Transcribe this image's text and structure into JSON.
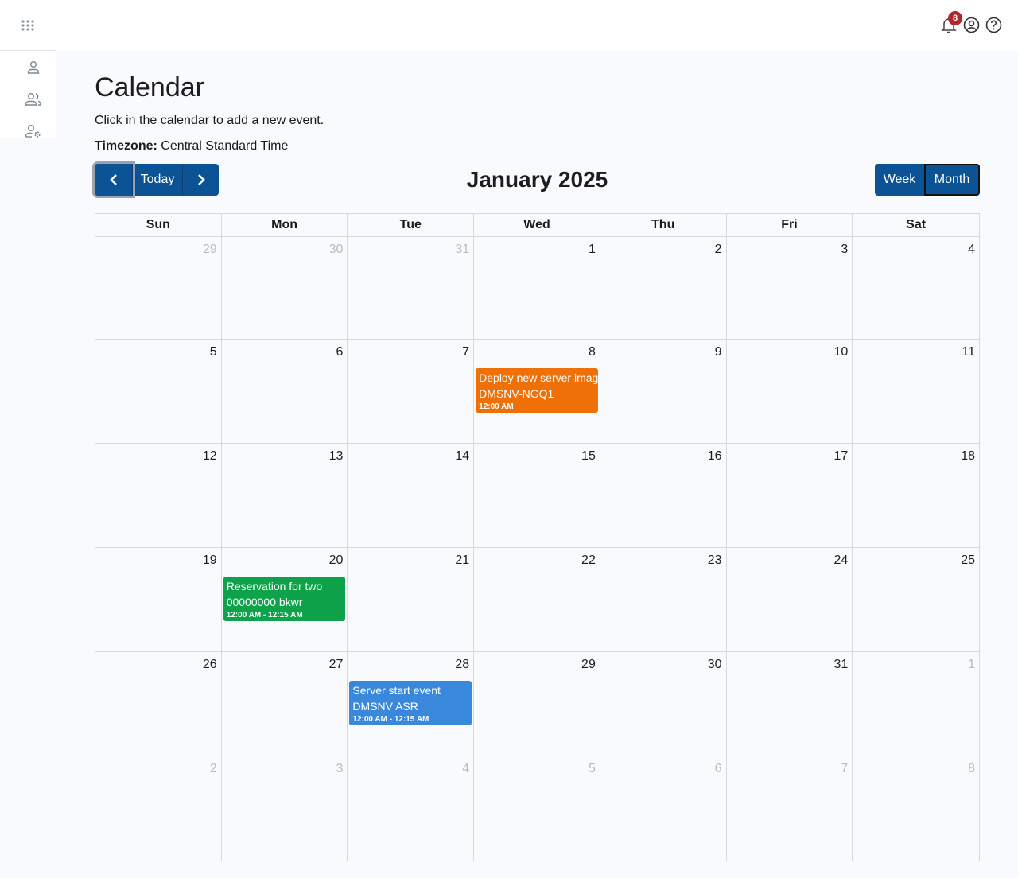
{
  "header": {
    "notifications_count": "8",
    "icons": [
      "apps-grid-icon",
      "bell-icon",
      "user-circle-icon",
      "help-icon"
    ]
  },
  "sidebar": {
    "items": [
      {
        "icon": "user-icon",
        "label": "User"
      },
      {
        "icon": "users-icon",
        "label": "Users"
      },
      {
        "icon": "user-settings-icon",
        "label": "User settings"
      }
    ]
  },
  "page": {
    "title": "Calendar",
    "subtitle": "Click in the calendar to add a new event.",
    "timezone_label": "Timezone:",
    "timezone_value": "Central Standard Time"
  },
  "toolbar": {
    "prev_label": "‹",
    "today_label": "Today",
    "next_label": "›",
    "month_title": "January 2025",
    "week_label": "Week",
    "month_label": "Month",
    "active_view": "Month"
  },
  "calendar": {
    "weekdays": [
      "Sun",
      "Mon",
      "Tue",
      "Wed",
      "Thu",
      "Fri",
      "Sat"
    ],
    "weeks": [
      [
        {
          "d": "29",
          "other": true
        },
        {
          "d": "30",
          "other": true
        },
        {
          "d": "31",
          "other": true
        },
        {
          "d": "1"
        },
        {
          "d": "2"
        },
        {
          "d": "3"
        },
        {
          "d": "4"
        }
      ],
      [
        {
          "d": "5"
        },
        {
          "d": "6"
        },
        {
          "d": "7"
        },
        {
          "d": "8"
        },
        {
          "d": "9"
        },
        {
          "d": "10"
        },
        {
          "d": "11"
        }
      ],
      [
        {
          "d": "12"
        },
        {
          "d": "13"
        },
        {
          "d": "14"
        },
        {
          "d": "15"
        },
        {
          "d": "16"
        },
        {
          "d": "17"
        },
        {
          "d": "18"
        }
      ],
      [
        {
          "d": "19"
        },
        {
          "d": "20"
        },
        {
          "d": "21"
        },
        {
          "d": "22"
        },
        {
          "d": "23"
        },
        {
          "d": "24"
        },
        {
          "d": "25"
        }
      ],
      [
        {
          "d": "26"
        },
        {
          "d": "27"
        },
        {
          "d": "28"
        },
        {
          "d": "29"
        },
        {
          "d": "30"
        },
        {
          "d": "31"
        },
        {
          "d": "1",
          "other": true
        }
      ],
      [
        {
          "d": "2",
          "other": true
        },
        {
          "d": "3",
          "other": true
        },
        {
          "d": "4",
          "other": true
        },
        {
          "d": "5",
          "other": true
        },
        {
          "d": "6",
          "other": true
        },
        {
          "d": "7",
          "other": true
        },
        {
          "d": "8",
          "other": true
        }
      ]
    ],
    "events": [
      {
        "week": 1,
        "day": 3,
        "title": "Deploy new server image",
        "subtitle": "DMSNV-NGQ1",
        "time": "12:00 AM",
        "color": "#f07008"
      },
      {
        "week": 3,
        "day": 1,
        "title": "Reservation for two",
        "subtitle": "00000000 bkwr",
        "time": "12:00 AM - 12:15 AM",
        "color": "#0ea24a"
      },
      {
        "week": 4,
        "day": 2,
        "title": "Server start event",
        "subtitle": "DMSNV ASR",
        "time": "12:00 AM - 12:15 AM",
        "color": "#3a88dc"
      }
    ]
  }
}
